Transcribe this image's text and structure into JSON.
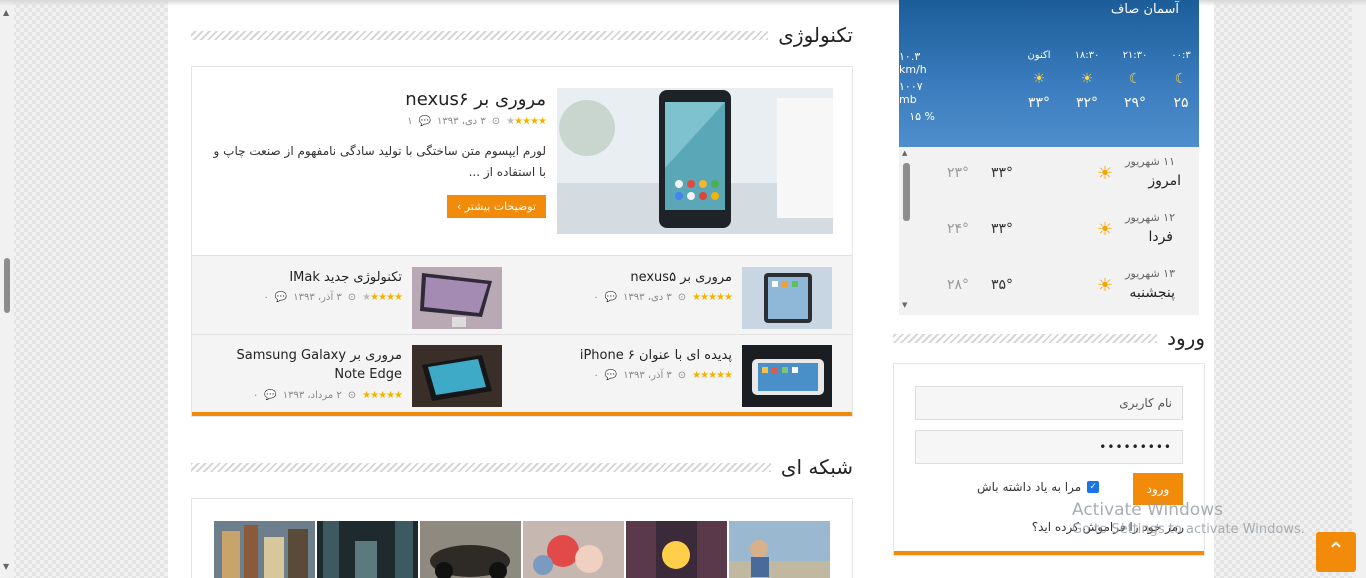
{
  "sections": {
    "tech_title": "تکنولوژی",
    "network_title": "شبکه ای",
    "login_title": "ورود"
  },
  "featured": {
    "title": "مروری بر nexus۶",
    "date": "۳ دی، ۱۳۹۳",
    "comments": "۱",
    "rating": 4,
    "excerpt": "لورم ایپسوم متن ساختگی با تولید سادگی نامفهوم از صنعت چاپ و با استفاده از ...",
    "more_label": "توضیحات بیشتر ›"
  },
  "posts": [
    {
      "title": "مروری بر nexus۵",
      "date": "۳ دی، ۱۳۹۳",
      "comments": "۰",
      "rating": 5
    },
    {
      "title": "تکنولوژی جدید IMak",
      "date": "۳ آذر، ۱۳۹۳",
      "comments": "۰",
      "rating": 4
    },
    {
      "title": "پدیده ای با عنوان iPhone ۶",
      "date": "۳ آذر، ۱۳۹۳",
      "comments": "۰",
      "rating": 5
    },
    {
      "title": "مروری بر Samsung Galaxy Note Edge",
      "date": "۲ مرداد، ۱۳۹۳",
      "comments": "۰",
      "rating": 5
    }
  ],
  "weather": {
    "condition": "آسمان صاف",
    "wind": "۱۰.۳ km/h",
    "pressure": "۱۰۰۷ mb",
    "humidity": "۱۵ %",
    "hourly": [
      {
        "time": "اکنون",
        "temp": "۳۳°",
        "icon": "sun-icon"
      },
      {
        "time": "۱۸:۳۰",
        "temp": "۳۲°",
        "icon": "sun-icon"
      },
      {
        "time": "۲۱:۳۰",
        "temp": "۲۹°",
        "icon": "moon-icon"
      },
      {
        "time": "۰۰:۳",
        "temp": "۲۵",
        "icon": "moon-icon"
      }
    ]
  },
  "forecast": [
    {
      "date": "۱۱ شهریور",
      "day": "امروز",
      "high": "۳۳°",
      "low": "۲۳°"
    },
    {
      "date": "۱۲ شهریور",
      "day": "فردا",
      "high": "۳۳°",
      "low": "۲۴°"
    },
    {
      "date": "۱۳ شهریور",
      "day": "پنجشنبه",
      "high": "۳۵°",
      "low": "۲۸°"
    }
  ],
  "login": {
    "username_placeholder": "نام کاربری",
    "password_value": "•••••••••",
    "remember_label": "مرا به یاد داشته باش",
    "submit_label": "ورود",
    "forgot_label": "رمز خود را فراموش کرده اید؟"
  },
  "watermark": {
    "line1": "Activate Windows",
    "line2": "Go to Settings to activate Windows."
  },
  "colors": {
    "accent": "#f28a0a",
    "weather_bg": "#1c5d99"
  }
}
